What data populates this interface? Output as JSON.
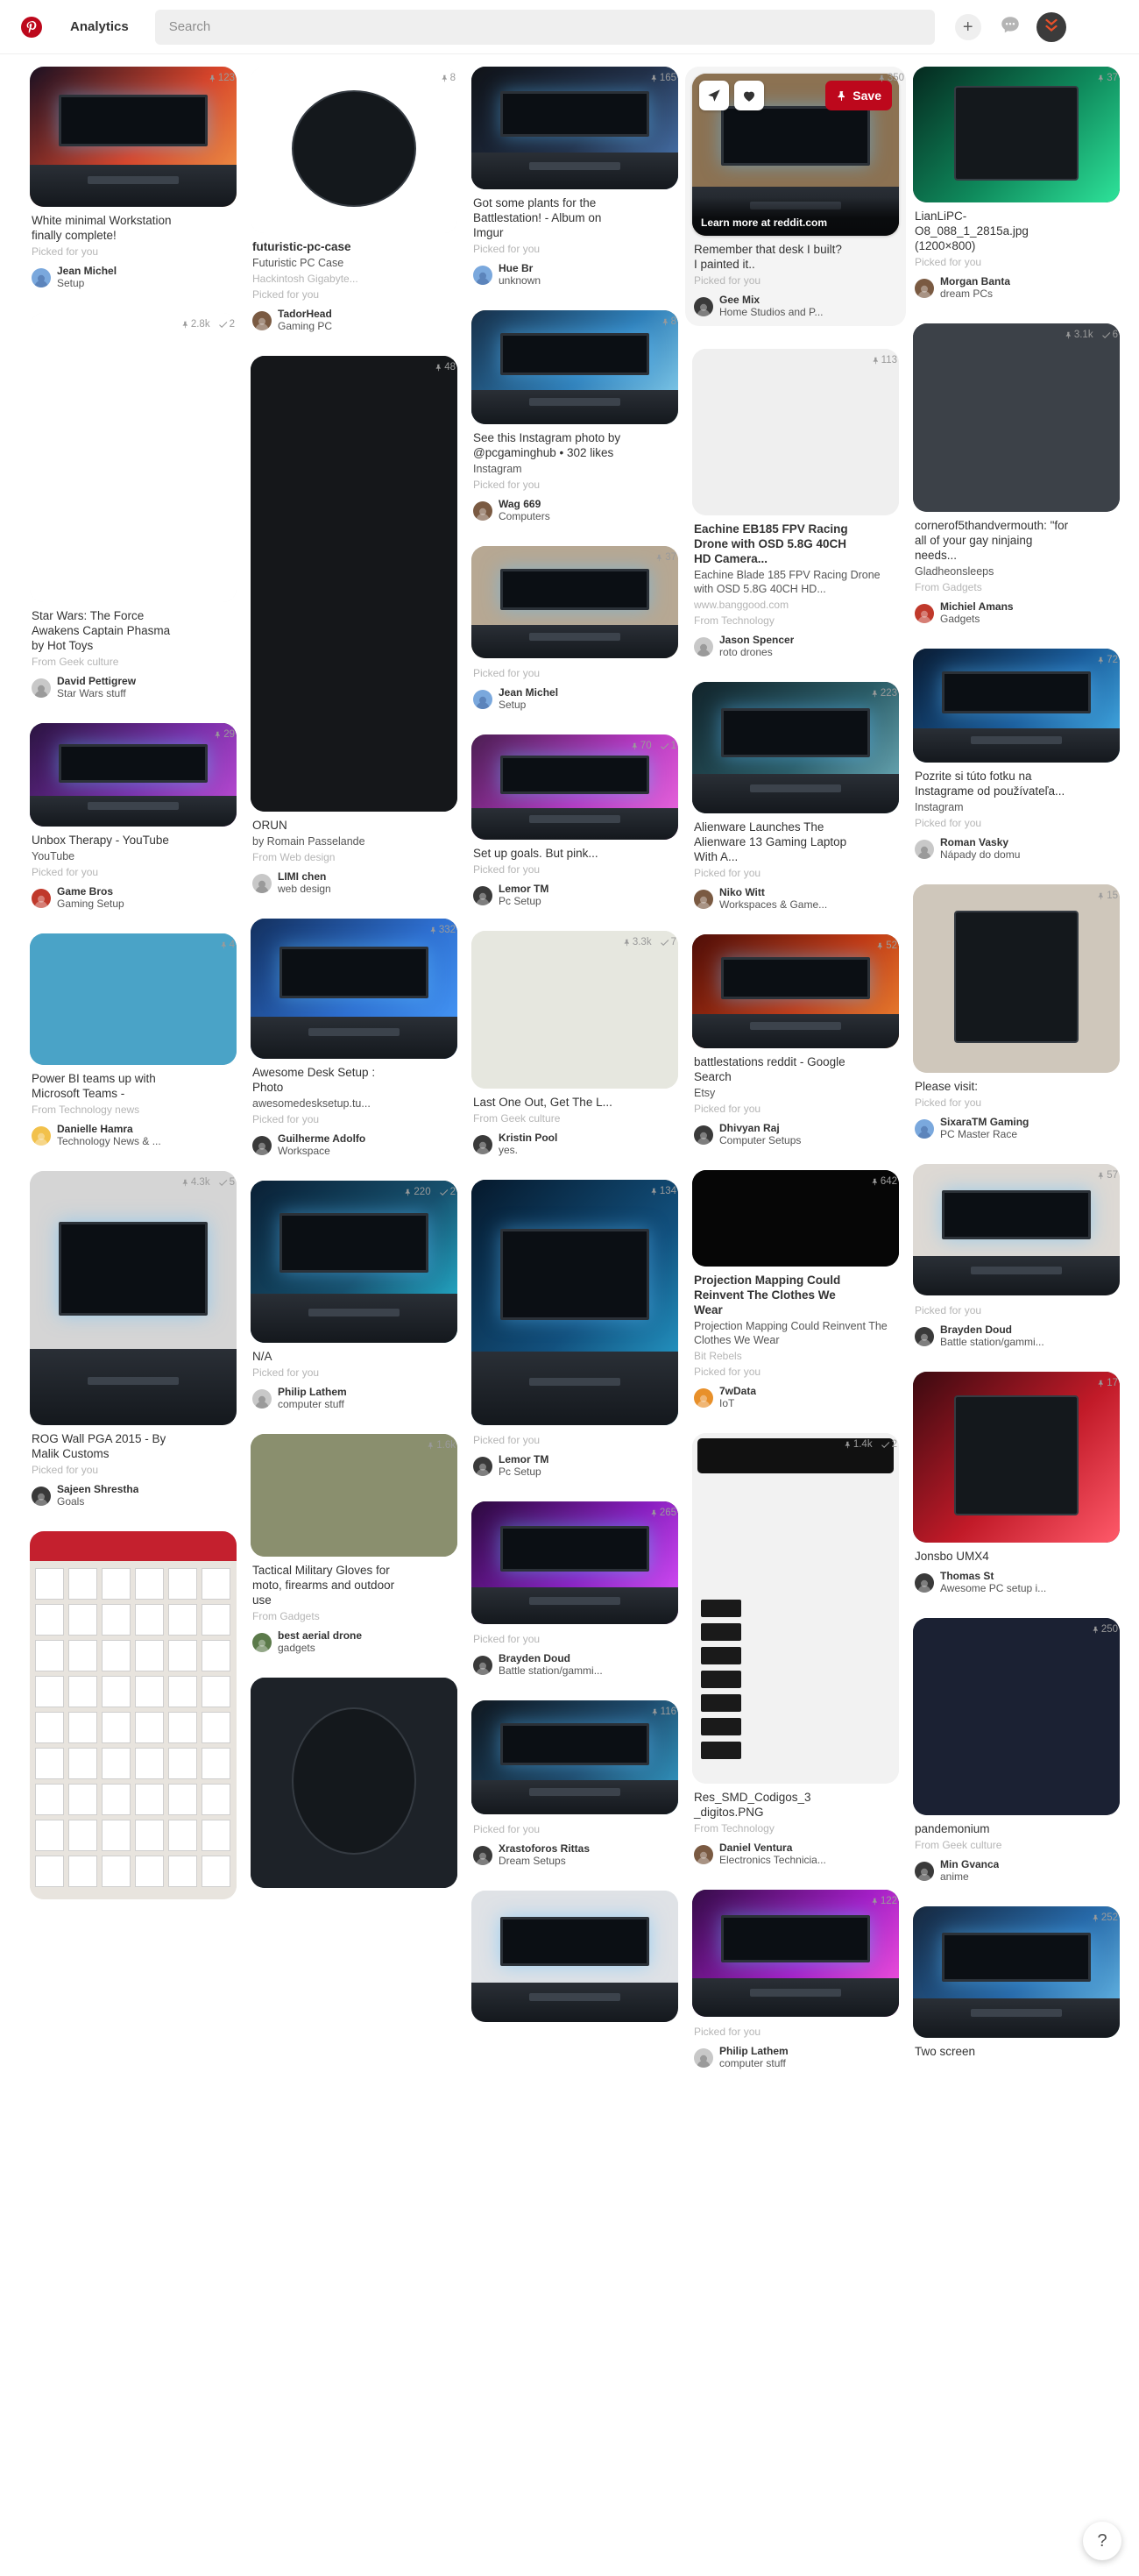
{
  "header": {
    "brand_icon": "pinterest-logo-icon",
    "nav_label": "Analytics",
    "search_placeholder": "Search",
    "search_value": "",
    "plus_icon": "plus-icon",
    "messages_icon": "chat-bubble-icon",
    "avatar_icon": "user-avatar-chevrons-icon",
    "accent_color": "#bd081c"
  },
  "help": {
    "label": "?"
  },
  "overlay": {
    "share_icon": "send-arrow-icon",
    "heart_icon": "heart-icon",
    "save_icon": "pin-icon",
    "save_label": "Save",
    "learn_more": "Learn more at reddit.com"
  },
  "labels": {
    "picked_for_you": "Picked for you",
    "pin_count_icon": "pushpin-icon",
    "tried_icon": "check-icon"
  },
  "columns": [
    {
      "pins": [
        {
          "title": "White minimal Workstation finally complete!",
          "sub": "Picked for you",
          "saves": "123",
          "tried": "",
          "user": "Jean Michel",
          "board": "Setup",
          "art": "desk-white",
          "avatar": "blue"
        },
        {
          "title": "Star Wars: The Force Awakens Captain Phasma by Hot Toys",
          "sub": "From Geek culture",
          "saves": "2.8k",
          "tried": "2",
          "user": "David Pettigrew",
          "board": "Star Wars stuff",
          "art": "phasma",
          "avatar": "grey"
        },
        {
          "title": "Unbox Therapy - YouTube",
          "desc": "YouTube",
          "sub": "Picked for you",
          "saves": "29",
          "tried": "",
          "user": "Game Bros",
          "board": "Gaming Setup",
          "art": "triple-purple",
          "avatar": "red"
        },
        {
          "title": "Power BI teams up with Microsoft Teams -",
          "sub": "From Technology news",
          "saves": "4",
          "tried": "",
          "user": "Danielle Hamra",
          "board": "Technology News & ...",
          "art": "meeting-illo",
          "avatar": "yellow"
        },
        {
          "title": "ROG Wall PGA 2015 - By Malik Customs",
          "sub": "Picked for you",
          "saves": "4.3k",
          "tried": "5",
          "user": "Sajeen Shrestha",
          "board": "Goals",
          "art": "wallmount",
          "avatar": "dark"
        },
        {
          "title": "",
          "sub": "",
          "saves": "",
          "tried": "",
          "user": "",
          "board": "",
          "art": "wireframe-kit",
          "avatar": "none"
        }
      ]
    },
    {
      "pins": [
        {
          "title": "futuristic-pc-case",
          "bold": true,
          "desc": "Futuristic PC Case",
          "sub2": "Hackintosh Gigabyte...",
          "sub": "Picked for you",
          "saves": "8",
          "tried": "",
          "user": "TadorHead",
          "board": "Gaming PC",
          "art": "round-case",
          "avatar": "brown"
        },
        {
          "title": "ORUN",
          "desc": "by Romain Passelande",
          "sub": "From Web design",
          "saves": "48",
          "tried": "",
          "user": "LIMI chen",
          "board": "web design",
          "art": "orun-dark",
          "avatar": "grey"
        },
        {
          "title": "Awesome Desk Setup : Photo",
          "desc": "awesomedesksetup.tu...",
          "sub": "Picked for you",
          "saves": "332",
          "tried": "",
          "user": "Guilherme Adolfo",
          "board": "Workspace",
          "art": "blue-corner-desk",
          "avatar": "dark"
        },
        {
          "title": "N/A",
          "sub": "Picked for you",
          "saves": "220",
          "tried": "2",
          "user": "Philip Lathem",
          "board": "computer stuff",
          "art": "ultrawide-dark",
          "avatar": "grey"
        },
        {
          "title": "Tactical Military Gloves for moto, firearms and outdoor use",
          "sub": "From Gadgets",
          "saves": "1.6k",
          "tried": "",
          "user": "best aerial drone",
          "board": "gadgets",
          "art": "gloves",
          "avatar": "green"
        },
        {
          "title": "",
          "sub": "",
          "saves": "",
          "tried": "",
          "user": "",
          "board": "",
          "art": "circuit-round",
          "avatar": "none"
        }
      ]
    },
    {
      "pins": [
        {
          "title": "Got some plants for the Battlestation! - Album on Imgur",
          "sub": "Picked for you",
          "saves": "165",
          "tried": "",
          "user": "Hue Br",
          "board": "unknown",
          "art": "gun-desk",
          "avatar": "blue"
        },
        {
          "title": "See this Instagram photo by @pcgaminghub • 302 likes",
          "desc": "Instagram",
          "sub": "Picked for you",
          "saves": "8",
          "tried": "",
          "user": "Wag 669",
          "board": "Computers",
          "art": "wood-desk-ultrawide",
          "avatar": "brown"
        },
        {
          "title": "",
          "sub": "Picked for you",
          "saves": "37",
          "tried": "",
          "user": "Jean Michel",
          "board": "Setup",
          "art": "beige-desk-tower",
          "avatar": "blue"
        },
        {
          "title": "Set up goals. But pink...",
          "sub": "Picked for you",
          "saves": "70",
          "tried": "1",
          "user": "Lemor TM",
          "board": "Pc Setup",
          "art": "pink-triple",
          "avatar": "dark"
        },
        {
          "title": "Last One Out, Get The L...",
          "sub": "From Geek culture",
          "saves": "3.3k",
          "tried": "7",
          "user": "Kristin Pool",
          "board": "yes.",
          "art": "robot-sketch",
          "avatar": "dark"
        },
        {
          "title": "",
          "sub": "Picked for you",
          "saves": "134",
          "tried": "",
          "user": "Lemor TM",
          "board": "Pc Setup",
          "art": "blue-standing-desk",
          "avatar": "dark"
        },
        {
          "title": "",
          "sub": "Picked for you",
          "saves": "265",
          "tried": "",
          "user": "Brayden Doud",
          "board": "Battle station/gammi...",
          "art": "purple-rgb-desk",
          "avatar": "dark"
        },
        {
          "title": "",
          "sub": "Picked for you",
          "saves": "116",
          "tried": "",
          "user": "Xrastoforos Rittas",
          "board": "Dream Setups",
          "art": "grey-curved-desk",
          "avatar": "dark"
        },
        {
          "title": "",
          "sub": "",
          "saves": "",
          "tried": "",
          "user": "",
          "board": "",
          "art": "white-minimal-desk",
          "avatar": "none"
        }
      ]
    },
    {
      "pins": [
        {
          "hovered": true,
          "title": "Remember that desk I built? I painted it..",
          "sub": "Picked for you",
          "saves": "350",
          "tried": "",
          "user": "Gee Mix",
          "board": "Home Studios and P...",
          "art": "wood-studio-desk",
          "avatar": "dark"
        },
        {
          "title": "Eachine EB185 FPV Racing Drone with OSD 5.8G 40CH HD Camera...",
          "bold": true,
          "desc": "Eachine Blade 185 FPV Racing Drone with OSD 5.8G 40CH HD...",
          "sub2": "www.banggood.com",
          "sub": "From Technology",
          "saves": "113",
          "tried": "",
          "user": "Jason Spencer",
          "board": "roto drones",
          "art": "drone",
          "avatar": "grey"
        },
        {
          "title": "Alienware Launches The Alienware 13 Gaming Laptop With A...",
          "sub": "Picked for you",
          "saves": "223",
          "tried": "",
          "user": "Niko Witt",
          "board": "Workspaces & Game...",
          "art": "alienware",
          "avatar": "brown"
        },
        {
          "title": "battlestations reddit - Google Search",
          "desc": "Etsy",
          "sub": "Picked for you",
          "saves": "52",
          "tried": "",
          "user": "Dhivyan Raj",
          "board": "Computer Setups",
          "art": "red-triple-desk",
          "avatar": "dark"
        },
        {
          "title": "Projection Mapping Could Reinvent The Clothes We Wear",
          "bold": true,
          "desc": "Projection Mapping Could Reinvent The Clothes We Wear",
          "sub2": "Bit Rebels",
          "sub": "Picked for you",
          "saves": "642",
          "tried": "",
          "user": "7wData",
          "board": "IoT",
          "art": "glowing-shoe",
          "avatar": "orange"
        },
        {
          "title": "Res_SMD_Codigos_3 _digitos.PNG",
          "sub": "From Technology",
          "saves": "1.4k",
          "tried": "2",
          "user": "Daniel Ventura",
          "board": "Electronics Technicia...",
          "art": "smd-chart",
          "avatar": "brown"
        },
        {
          "title": "",
          "sub": "Picked for you",
          "saves": "122",
          "tried": "",
          "user": "Philip Lathem",
          "board": "computer stuff",
          "art": "neon-laptop",
          "avatar": "grey"
        }
      ]
    },
    {
      "pins": [
        {
          "title": "LianLiPC-O8_088_1_2815a.jpg (1200×800)",
          "sub": "Picked for you",
          "saves": "37",
          "tried": "",
          "user": "Morgan Banta",
          "board": "dream PCs",
          "art": "green-lianli",
          "avatar": "brown"
        },
        {
          "title": "cornerof5thandvermouth: \"for all of your gay ninjaing needs...",
          "desc": "Gladheonsleeps",
          "sub": "From Gadgets",
          "saves": "3.1k",
          "tried": "6",
          "user": "Michiel Amans",
          "board": "Gadgets",
          "art": "rainbow-blades",
          "avatar": "red"
        },
        {
          "title": "Pozrite si túto fotku na Instagrame od používateľa...",
          "desc": "Instagram",
          "sub": "Picked for you",
          "saves": "72",
          "tried": "",
          "user": "Roman Vasky",
          "board": "Nápady do domu",
          "art": "blue-room-setup",
          "avatar": "grey"
        },
        {
          "title": "Please visit:",
          "sub": "Picked for you",
          "saves": "15",
          "tried": "",
          "user": "SixaraTM Gaming",
          "board": "PC Master Race",
          "art": "casemod-black",
          "avatar": "blue"
        },
        {
          "title": "",
          "sub": "Picked for you",
          "saves": "57",
          "tried": "",
          "user": "Brayden Doud",
          "board": "Battle station/gammi...",
          "art": "white-gaming-room",
          "avatar": "dark"
        },
        {
          "title": "Jonsbo UMX4",
          "desc": "",
          "sub": "",
          "saves": "17",
          "tried": "",
          "user": "Thomas St",
          "board": "Awesome PC setup i...",
          "art": "red-rgb-case",
          "avatar": "dark"
        },
        {
          "title": "pandemonium",
          "sub": "From Geek culture",
          "saves": "250",
          "tried": "",
          "user": "Min Gvanca",
          "board": "anime",
          "art": "anime-priest",
          "avatar": "dark"
        },
        {
          "title": "Two screen",
          "sub": "",
          "saves": "252",
          "tried": "",
          "user": "",
          "board": "",
          "art": "two-screen",
          "avatar": "none"
        }
      ]
    }
  ]
}
